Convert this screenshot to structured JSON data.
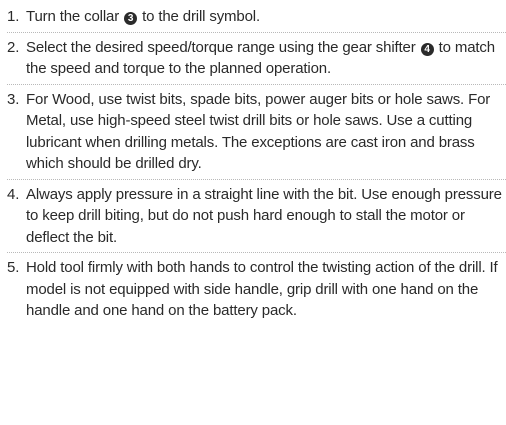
{
  "steps": [
    {
      "number": "1.",
      "before": "Turn the collar ",
      "badge": "3",
      "after": " to the drill symbol."
    },
    {
      "number": "2.",
      "before": "Select the desired speed/torque range using the gear shifter ",
      "badge": "4",
      "after": " to match the speed and torque to the planned operation."
    },
    {
      "number": "3.",
      "text": "For Wood, use twist bits, spade bits, power auger bits or hole saws. For Metal, use high-speed steel twist drill bits or hole saws. Use a cutting lubricant when drilling metals. The exceptions are cast iron and brass which should be drilled dry."
    },
    {
      "number": "4.",
      "text": "Always apply pressure in a straight line with the bit. Use enough pressure to keep drill biting, but do not push hard enough to stall the motor or deflect the bit."
    },
    {
      "number": "5.",
      "text": "Hold tool firmly with both hands to control the twisting action of the drill. If model is not equipped with side handle, grip drill with one hand on the handle and one hand on the battery pack."
    }
  ]
}
